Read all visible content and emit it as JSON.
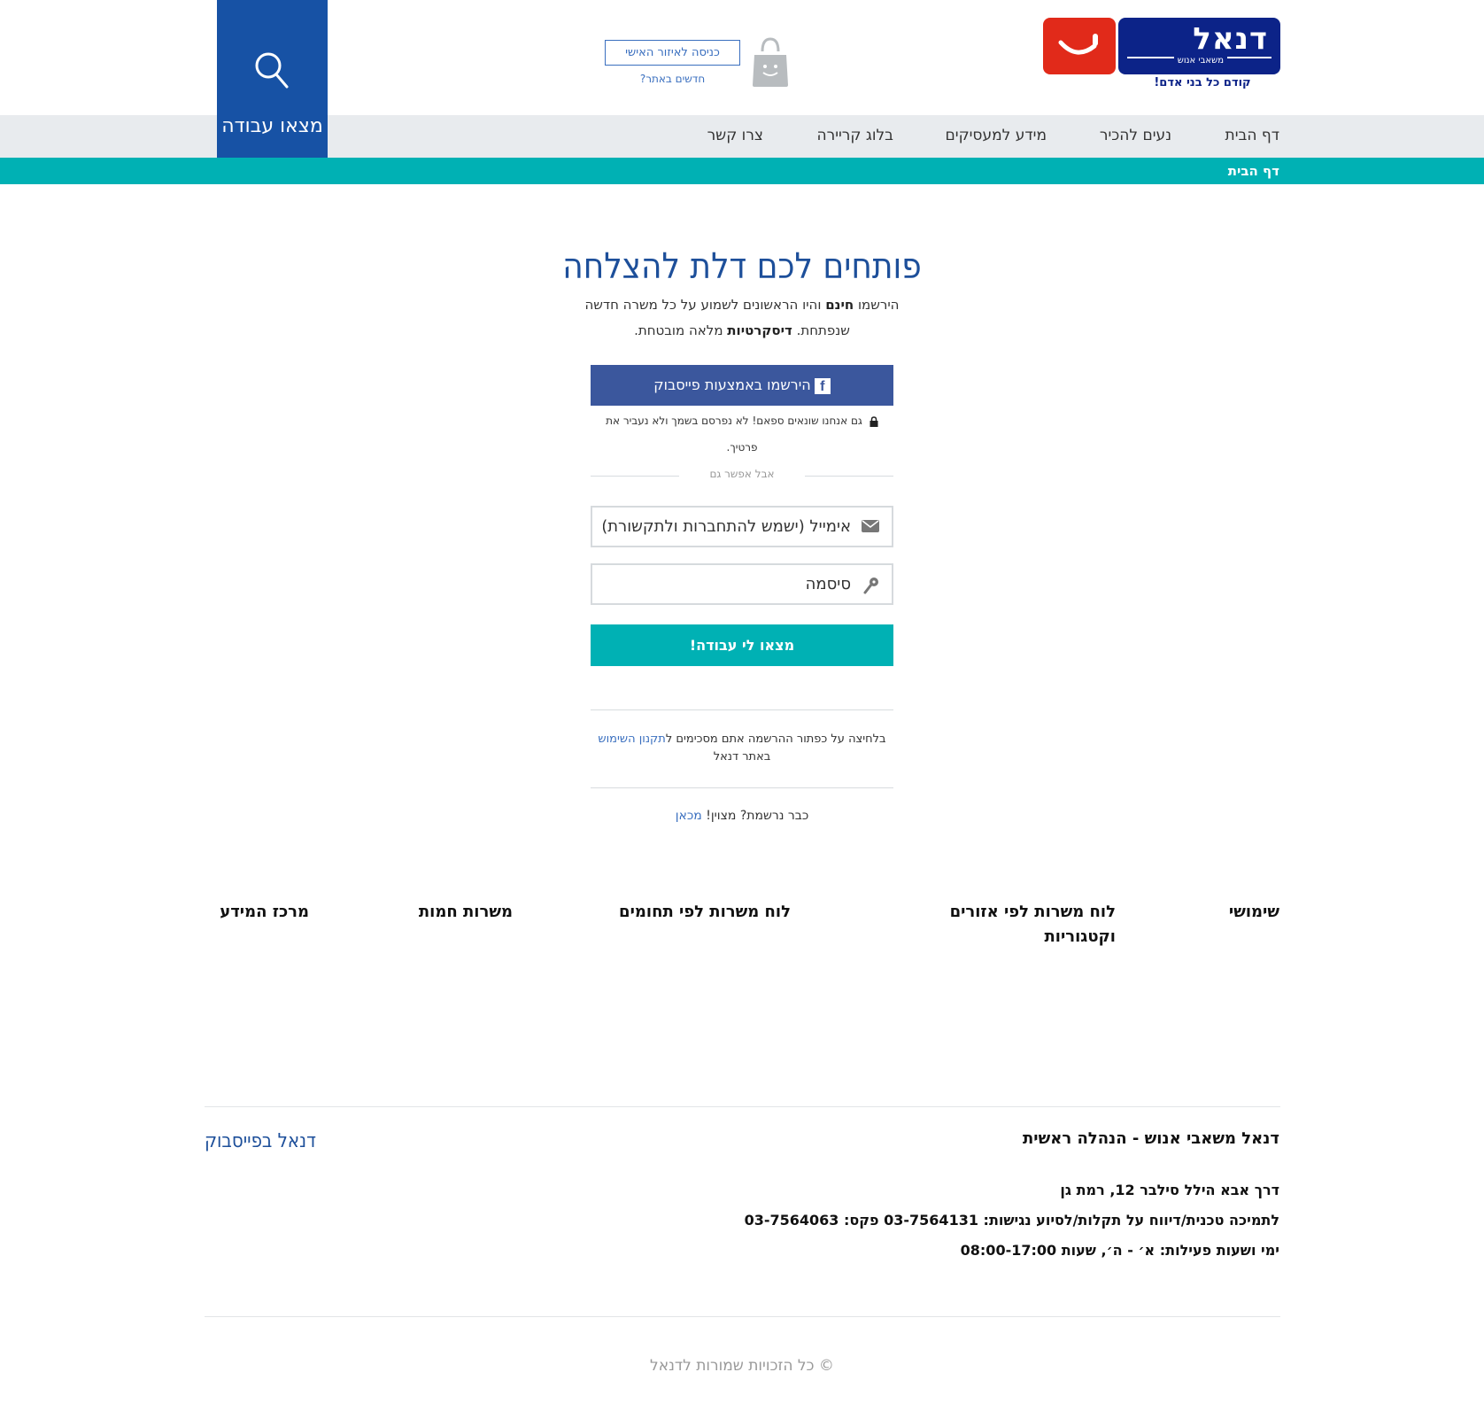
{
  "header": {
    "logo_word": "דנאל",
    "logo_sub": "משאבי אנוש",
    "logo_tagline": "קודם כל בני אדם!",
    "login_button": "כניסה לאיזור האישי",
    "new_link": "חדשים באתר?",
    "search_label": "מצאו עבודה"
  },
  "nav": {
    "items": [
      "דף הבית",
      "נעים להכיר",
      "מידע למעסיקים",
      "בלוג קריירה",
      "צרו קשר"
    ]
  },
  "breadcrumb": "דף הבית",
  "signup": {
    "title": "פותחים לכם דלת להצלחה",
    "sub_1": "הירשמו ",
    "sub_free": "חינם",
    "sub_2": " והיו הראשונים לשמוע על כל משרה חדשה שנפתחת. ",
    "sub_discreet": "דיסקרטיות",
    "sub_3": " מלאה מובטחת.",
    "facebook_button": "הירשמו באמצעות פייסבוק",
    "spam_note": "גם אנחנו שונאים ספאם! לא נפרסם בשמך ולא נעביר את פרטיך.",
    "or_text": "אבל אפשר גם",
    "email_placeholder": "אימייל (ישמש להתחברות ולתקשורת)",
    "password_placeholder": "סיסמה",
    "submit_button": "מצאו לי עבודה!",
    "terms_1": "בלחיצה על כפתור ההרשמה אתם מסכימים ל",
    "terms_link": "תקנון השימוש",
    "terms_2": " באתר דנאל",
    "already_1": "כבר נרשמת? מצוין! ",
    "already_link": "מכאן"
  },
  "footer": {
    "columns": [
      "שימושי",
      "לוח משרות לפי אזורים וקטגוריות",
      "לוח משרות לפי תחומים",
      "משרות חמות",
      "מרכז המידע"
    ],
    "hq_title": "דנאל משאבי אנוש - הנהלה ראשית",
    "address": "דרך אבא הילל סילבר 12, רמת גן",
    "support": "לתמיכה טכנית/דיווח על תקלות/לסיוע נגישות: 03-7564131 פקס: 03-7564063",
    "hours": "ימי ושעות פעילות: א׳ - ה׳, שעות 08:00-17:00",
    "facebook_page": "דנאל בפייסבוק",
    "copyright": "© כל הזכויות שמורות לדנאל"
  },
  "colors": {
    "brand_blue": "#1752a5",
    "logo_navy": "#0c2388",
    "logo_red": "#e12a1a",
    "teal": "#00b1b4",
    "facebook": "#3b579d"
  }
}
